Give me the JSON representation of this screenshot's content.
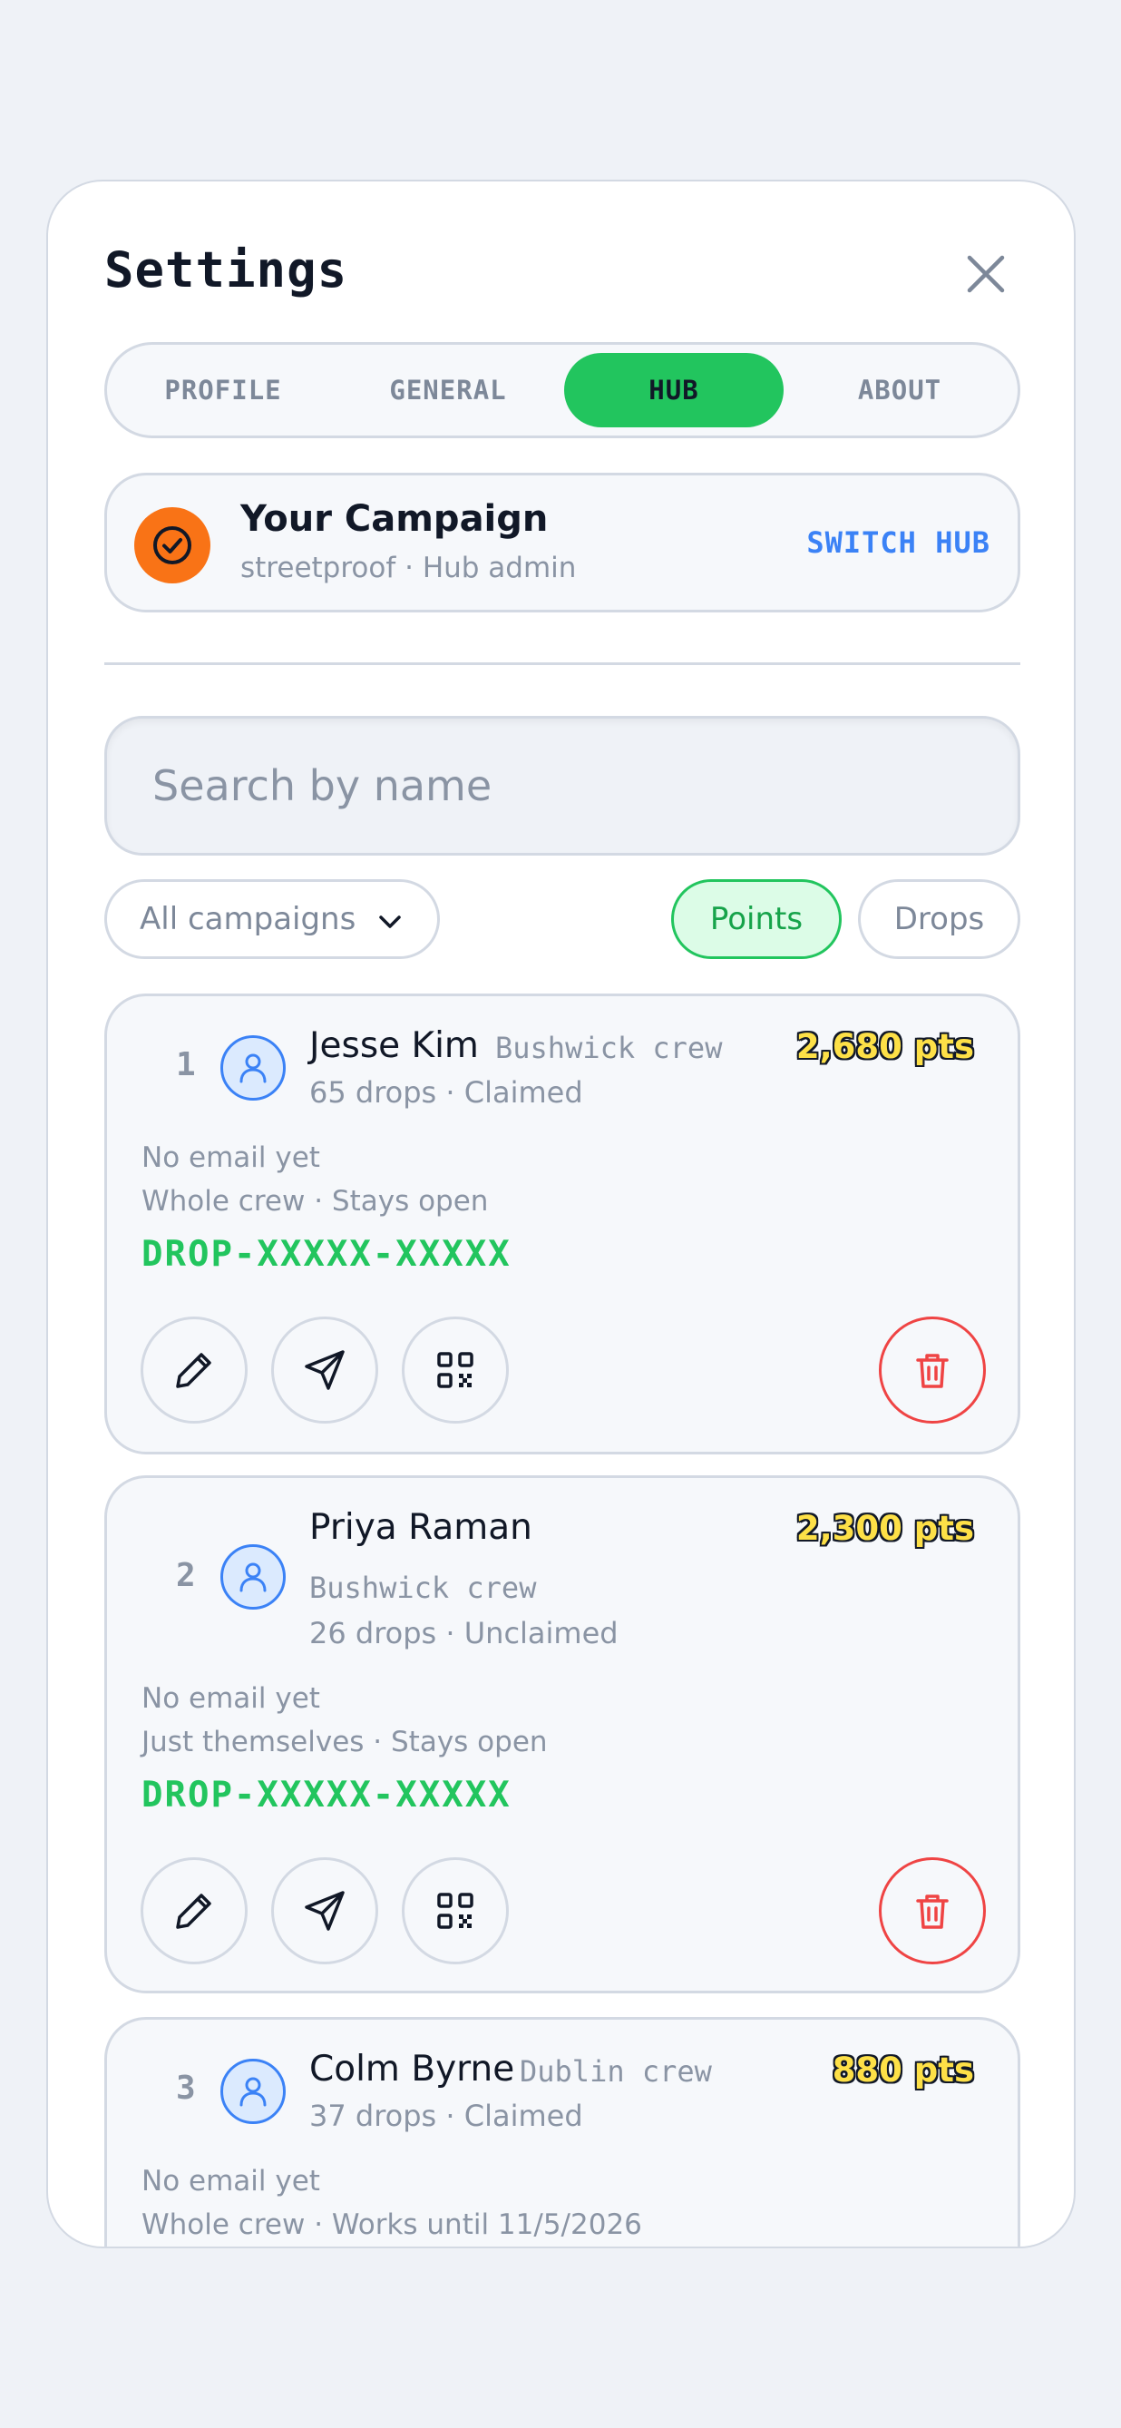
{
  "settings": {
    "title": "Settings",
    "tabs": [
      {
        "label": "PROFILE",
        "active": false
      },
      {
        "label": "GENERAL",
        "active": false
      },
      {
        "label": "HUB",
        "active": true
      },
      {
        "label": "ABOUT",
        "active": false
      }
    ]
  },
  "hub": {
    "name": "Your Campaign",
    "subtitle": "streetproof · Hub admin",
    "switch_label": "SWITCH HUB"
  },
  "search": {
    "placeholder": "Search by name",
    "value": ""
  },
  "filters": {
    "campaign_dropdown": "All campaigns",
    "sort_points": "Points",
    "sort_drops": "Drops",
    "active_sort": "Points"
  },
  "members": [
    {
      "rank": "1",
      "name": "Jesse Kim",
      "crew": "Bushwick crew",
      "stats": "65 drops · Claimed",
      "points": "2,680 pts",
      "email": "No email yet",
      "scope": "Whole crew · Stays open",
      "code": "DROP-XXXXX-XXXXX"
    },
    {
      "rank": "2",
      "name": "Priya Raman",
      "crew": "Bushwick crew",
      "stats": "26 drops · Unclaimed",
      "points": "2,300 pts",
      "email": "No email yet",
      "scope": "Just themselves · Stays open",
      "code": "DROP-XXXXX-XXXXX"
    },
    {
      "rank": "3",
      "name": "Colm Byrne",
      "crew": "Dublin crew",
      "stats": "37 drops · Claimed",
      "points": "880 pts",
      "email": "No email yet",
      "scope": "Whole crew · Works until 11/5/2026",
      "code": ""
    }
  ],
  "colors": {
    "accent_green": "#22c55e",
    "hub_badge": "#f97316",
    "link_blue": "#3b82f6",
    "danger_red": "#ef4444",
    "points_yellow": "#fde047"
  }
}
